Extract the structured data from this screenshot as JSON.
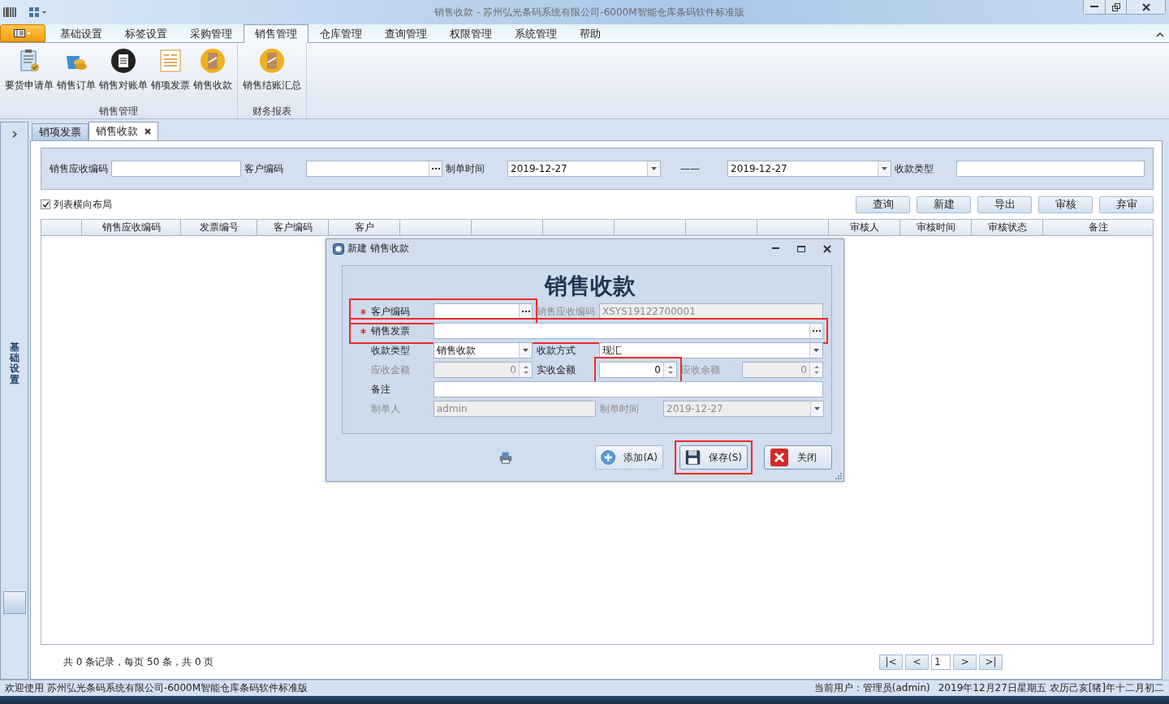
{
  "window": {
    "title": "销售收款 - 苏州弘光条码系统有限公司-6000M智能仓库条码软件标准版"
  },
  "ribbon": {
    "tabs": [
      {
        "label": "基础设置",
        "selected": false
      },
      {
        "label": "标签设置",
        "selected": false
      },
      {
        "label": "采购管理",
        "selected": false
      },
      {
        "label": "销售管理",
        "selected": true
      },
      {
        "label": "仓库管理",
        "selected": false
      },
      {
        "label": "查询管理",
        "selected": false
      },
      {
        "label": "权限管理",
        "selected": false
      },
      {
        "label": "系统管理",
        "selected": false
      },
      {
        "label": "帮助",
        "selected": false
      }
    ],
    "groups": [
      {
        "label": "销售管理",
        "items": [
          {
            "label": "要货申请单",
            "kind": "clipboard"
          },
          {
            "label": "销售订单",
            "kind": "coins"
          },
          {
            "label": "销售对账单",
            "kind": "notepad"
          },
          {
            "label": "销项发票",
            "kind": "invoice"
          },
          {
            "label": "销售收款",
            "kind": "badge"
          }
        ]
      },
      {
        "label": "财务报表",
        "items": [
          {
            "label": "销售结账汇总",
            "kind": "badge"
          }
        ]
      }
    ]
  },
  "side_panel": {
    "label": "基础设置"
  },
  "doc_tabs": [
    {
      "label": "销项发票",
      "selected": false,
      "closable": false
    },
    {
      "label": "销售收款",
      "selected": true,
      "closable": true
    }
  ],
  "filter": {
    "fields": [
      {
        "label": "销售应收编码",
        "kind": "text"
      },
      {
        "label": "客户编码",
        "kind": "lookup"
      },
      {
        "label": "制单时间",
        "kind": "date",
        "value": "2019-12-27"
      },
      {
        "kind": "separator",
        "label": "——"
      },
      {
        "kind": "date",
        "value": "2019-12-27"
      },
      {
        "label": "收款类型",
        "kind": "text"
      }
    ]
  },
  "layout_toggle": {
    "label": "列表横向布局",
    "checked": true
  },
  "actions": [
    "查询",
    "新建",
    "导出",
    "审核",
    "弃审"
  ],
  "table": {
    "columns": [
      {},
      {
        "label": "销售应收编码"
      },
      {
        "label": "发票编号"
      },
      {
        "label": "客户编码"
      },
      {
        "label": "客户"
      },
      {},
      {},
      {},
      {},
      {},
      {},
      {
        "label": "审核人"
      },
      {
        "label": "审核时间"
      },
      {
        "label": "审核状态"
      },
      {
        "label": "备注"
      }
    ]
  },
  "pager": {
    "summary": "共 0 条记录，每页 50 条，共 0 页",
    "page": "1",
    "buttons": [
      "|<",
      "<",
      ">",
      ">|"
    ]
  },
  "dialog": {
    "title": "新建 销售收款",
    "heading": "销售收款",
    "rows": [
      [
        {
          "label": "客户编码",
          "kind": "lookup",
          "required": true,
          "disabled": false,
          "highlighted": true
        },
        {
          "label": "销售应收编码",
          "kind": "text",
          "disabled": true,
          "value": "XSYS19122700001"
        }
      ],
      [
        {
          "label": "销售发票",
          "kind": "lookup",
          "required": true,
          "disabled": false,
          "highlighted": true
        }
      ],
      [
        {
          "label": "收款类型",
          "kind": "combo",
          "value": "销售收款",
          "required": false,
          "disabled": false
        },
        {
          "label": "收款方式",
          "kind": "combo",
          "value": "现汇",
          "disabled": false
        }
      ],
      [
        {
          "label": "应收金额",
          "kind": "spin",
          "value": "0",
          "disabled": true,
          "required": false
        },
        {
          "label": "实收金额",
          "kind": "spin",
          "value": "0",
          "disabled": false,
          "highlighted": true
        },
        {
          "label": "应收余额",
          "kind": "spin",
          "value": "0",
          "disabled": true
        }
      ],
      [
        {
          "label": "备注",
          "kind": "text",
          "required": false,
          "disabled": false
        }
      ],
      [
        {
          "label": "制单人",
          "kind": "text",
          "value": "admin",
          "disabled": true,
          "required": false
        },
        {
          "label": "制单时间",
          "kind": "combo",
          "value": "2019-12-27",
          "disabled": true
        }
      ]
    ],
    "buttons": [
      {
        "label": "添加(A)",
        "kind": "add",
        "highlighted": false
      },
      {
        "label": "保存(S)",
        "kind": "save",
        "highlighted": true
      },
      {
        "label": "关闭",
        "kind": "close",
        "highlighted": false
      }
    ]
  },
  "status_bar": {
    "left": "欢迎使用 苏州弘光条码系统有限公司-6000M智能仓库条码软件标准版",
    "user": "当前用户：管理员(admin)",
    "date": "2019年12月27日星期五 农历己亥[猪]年十二月初二"
  }
}
